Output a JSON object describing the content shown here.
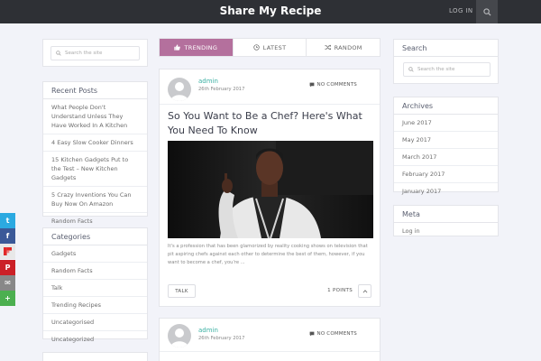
{
  "header": {
    "title": "Share My Recipe",
    "login_label": "LOG IN",
    "search_icon": "search-icon"
  },
  "left_search": {
    "placeholder": "Search the site"
  },
  "recent_posts": {
    "title": "Recent Posts",
    "items": [
      "What People Don't Understand Unless They Have Worked In A Kitchen",
      "4 Easy Slow Cooker Dinners",
      "15 Kitchen Gadgets Put to the Test – New Kitchen Gadgets",
      "5 Crazy Inventions You Can Buy Now On Amazon",
      "Random Facts"
    ]
  },
  "categories": {
    "title": "Categories",
    "items": [
      "Gadgets",
      "Random Facts",
      "Talk",
      "Trending Recipes",
      "Uncategorised",
      "Uncategorized"
    ]
  },
  "tabs": [
    {
      "label": "TRENDING",
      "icon": "thumbs-up-icon",
      "active": true
    },
    {
      "label": "LATEST",
      "icon": "clock-icon",
      "active": false
    },
    {
      "label": "RANDOM",
      "icon": "shuffle-icon",
      "active": false
    }
  ],
  "posts": [
    {
      "author": "admin",
      "date": "26th February 2017",
      "comments": "NO COMMENTS",
      "title": "So You Want to Be a Chef? Here's What You Need To Know",
      "excerpt": "It's a profession that has been glamorized by reality cooking shows on television that pit aspiring chefs against each other to determine the best of them, however, if you want to become a chef, you're ...",
      "tag": "TALK",
      "points": "1 POINTS"
    },
    {
      "author": "admin",
      "date": "26th February 2017",
      "comments": "NO COMMENTS"
    }
  ],
  "right_search": {
    "title": "Search",
    "placeholder": "Search the site"
  },
  "archives": {
    "title": "Archives",
    "items": [
      "June 2017",
      "May 2017",
      "March 2017",
      "February 2017",
      "January 2017"
    ]
  },
  "meta": {
    "title": "Meta",
    "items": [
      "Log in"
    ]
  },
  "share_bar": [
    {
      "network": "twitter",
      "glyph": "t",
      "color": "#2ba9e1"
    },
    {
      "network": "facebook",
      "glyph": "f",
      "color": "#3b5998"
    },
    {
      "network": "pinterest",
      "glyph": "P",
      "color": "#cb2027"
    },
    {
      "network": "email",
      "glyph": "✉",
      "color": "#888888"
    },
    {
      "network": "more",
      "glyph": "+",
      "color": "#4caf50"
    }
  ],
  "colors": {
    "accent": "#b4709d",
    "author": "#3bb0a3",
    "topbar": "#2e3035"
  }
}
